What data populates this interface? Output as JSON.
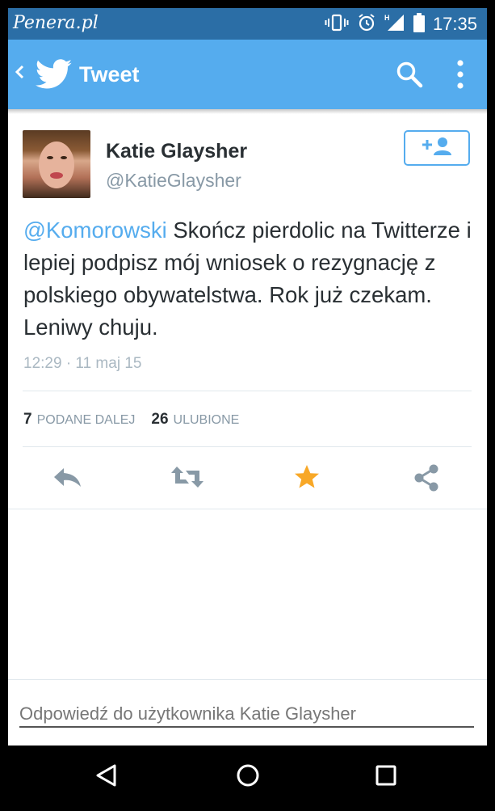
{
  "statusbar": {
    "watermark": "Penera.pl",
    "time": "17:35",
    "icons": [
      "vibrate-icon",
      "alarm-icon",
      "signal-icon",
      "battery-icon"
    ]
  },
  "actionbar": {
    "title": "Tweet",
    "icons": [
      "back-chevron-icon",
      "twitter-bird-icon",
      "search-icon",
      "more-vertical-icon"
    ]
  },
  "tweet": {
    "author_name": "Katie Glaysher",
    "author_handle": "@KatieGlaysher",
    "mention": "@Komorowski",
    "body": " Skończ pierdolic na Twitterze i lepiej podpisz mój wniosek o rezygnację z polskiego obywatelstwa. Rok już czekam. Leniwy chuju.",
    "timestamp": "12:29 · 11 maj 15",
    "retweet_count": "7",
    "retweet_label": "PODANE DALEJ",
    "favorite_count": "26",
    "favorite_label": "ULUBIONE",
    "favorited": true
  },
  "reply": {
    "placeholder": "Odpowiedź do użytkownika Katie Glaysher"
  },
  "colors": {
    "twitter_blue": "#55acee",
    "status_bar": "#2b6ea6",
    "favorite_star": "#f8a827",
    "action_gray": "#8899a6"
  }
}
